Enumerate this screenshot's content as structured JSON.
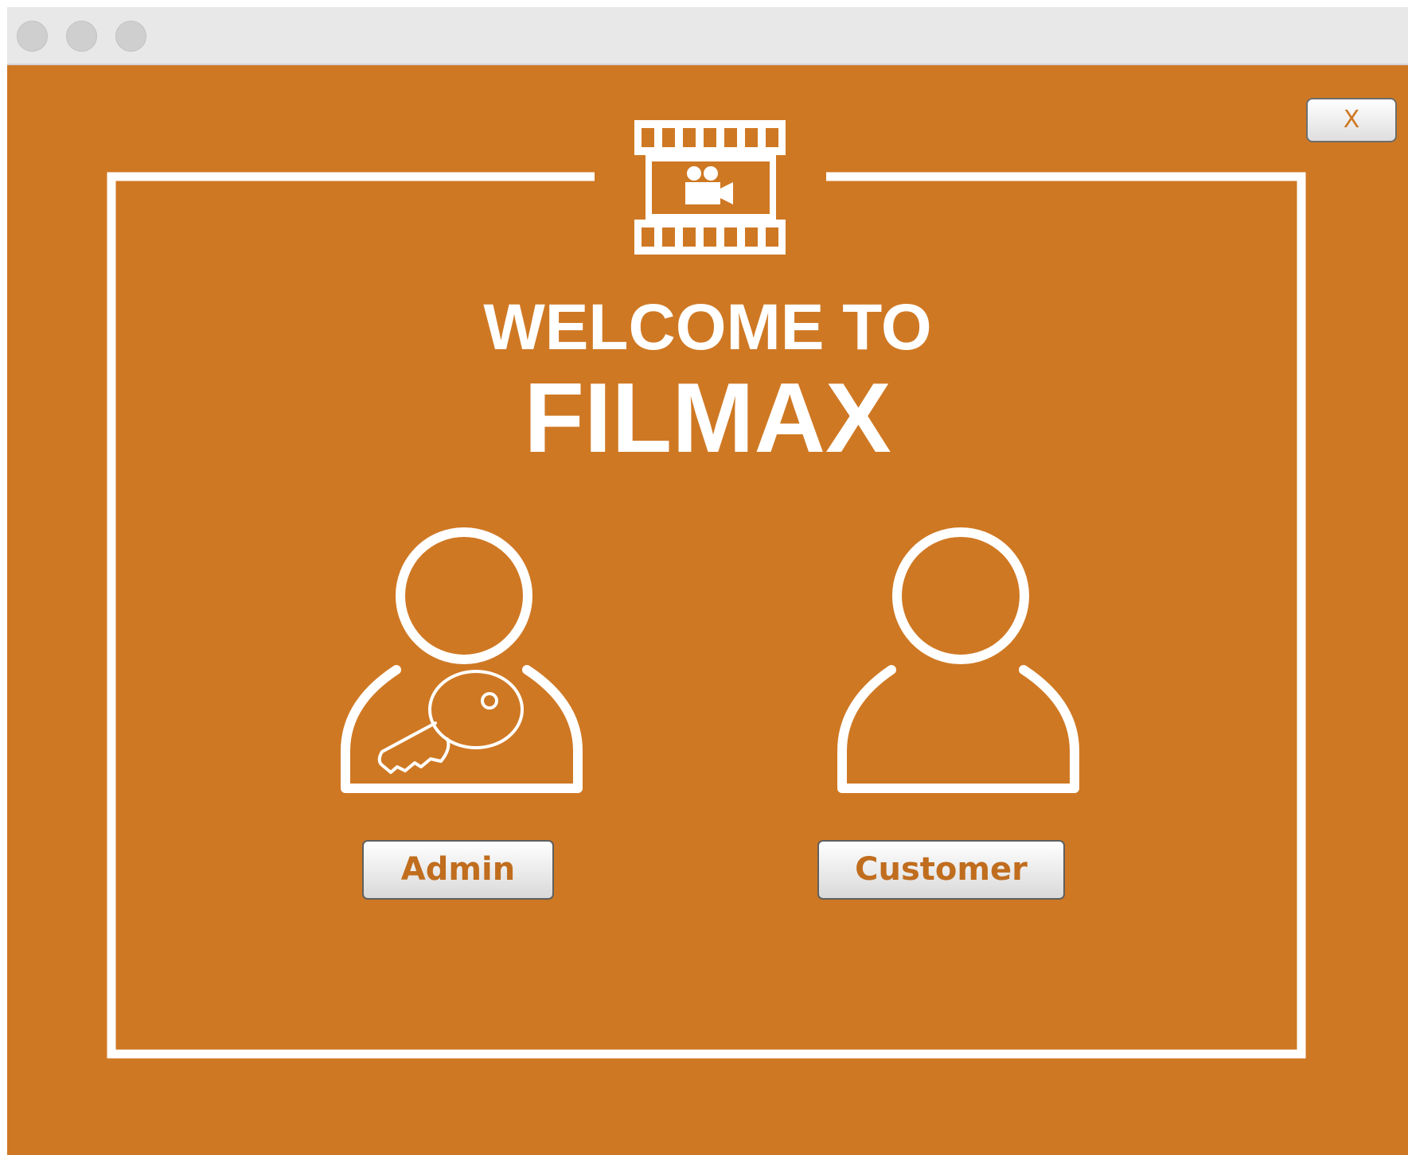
{
  "window": {
    "controls": [
      "close-dot",
      "minimize-dot",
      "zoom-dot"
    ]
  },
  "close_button": {
    "label": "X"
  },
  "welcome": {
    "line1": "WELCOME TO",
    "line2": "FILMAX"
  },
  "roles": {
    "admin": {
      "label": "Admin",
      "icon": "user-key-icon"
    },
    "customer": {
      "label": "Customer",
      "icon": "user-icon"
    }
  },
  "logo": {
    "icon": "film-camera-icon"
  },
  "colors": {
    "background": "#cf7823",
    "foreground": "#ffffff",
    "button_text": "#c06d1e"
  }
}
